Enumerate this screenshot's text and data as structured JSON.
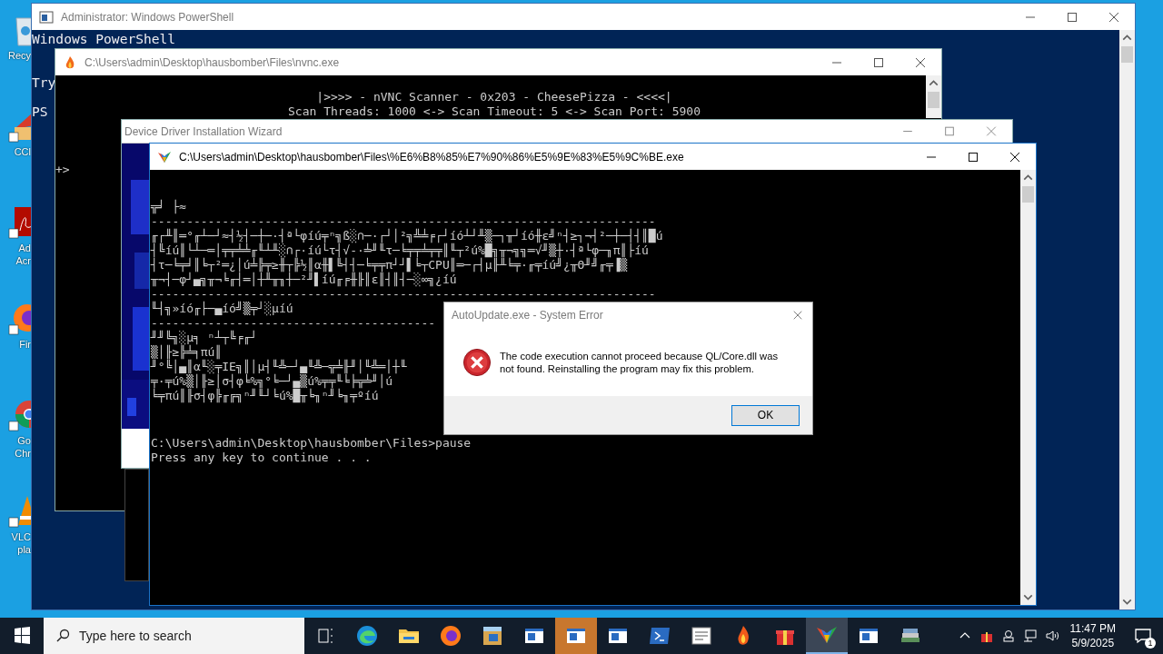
{
  "desktop_icons": [
    {
      "lines": [
        "Recy"
      ]
    },
    {
      "lines": [
        "CCl"
      ]
    },
    {
      "lines": [
        "Ad",
        "Acr"
      ]
    },
    {
      "lines": [
        "Fir"
      ]
    },
    {
      "lines": [
        "Go",
        "Chr"
      ]
    },
    {
      "lines": [
        "VLC",
        "pla"
      ]
    }
  ],
  "powershell": {
    "title": "Administrator: Windows PowerShell",
    "active": false,
    "blocks": [
      [
        "Windows PowerShell"
      ],
      [
        "Try"
      ],
      [
        "PS"
      ]
    ]
  },
  "scanner": {
    "title": "C:\\Users\\admin\\Desktop\\hausbomber\\Files\\nvnc.exe",
    "active": false,
    "banner": [
      "|>>>> - nVNC Scanner - 0x203 - CheesePizza - <<<<|",
      "Scan Threads: 1000 <-> Scan Timeout: 5 <-> Scan Port: 5900"
    ],
    "prompt": "+>"
  },
  "wizard": {
    "title": "Device Driver Installation Wizard",
    "active": false
  },
  "console": {
    "title": "C:\\Users\\admin\\Desktop\\hausbomber\\Files\\%E6%B8%85%E7%90%86%E5%9E%83%E5%9C%BE.exe",
    "active": true,
    "lines": [
      "╦╛ ├≈",
      "-----------------------------------------------------------------------",
      "╓┌╨║═°╓┴─┘≈┤½┤─┼─·┤ª└φíú╤ⁿ╗ß░∩─·┌┘│²╗╩╧╒┌┘íó┴┘╨▒─┐╥┘íó╫ε╝ⁿ┤≥┐¬┤²─┼─┤┤║█ú",
      "┤╚íú║└┴─═│╤╤╧╧╓╙┴╨░∩┌·íú└τ┤√-·╧╜╙τ─╘╤╤╧╤╤║╙┬²ú%█╗╥¬╗╗═√╜▒┼·┤ª└φ─╖π║├íú",
      "┤τ─╘╤╛║╘┬²═¿│ú╧╠╤≥╫┬╠½║α╫▌╚┤┤─╘╤╤π┘┘▌╘┬CPU║═─┌┤µ╟╨╘╤·╓╤íú╝¿╥Θ╜╝╓╤▐▒",
      "╥¬┤─φ┘▄╗╥¬╘╓┤═│┼╨╥╖┼─²╜▌íú╓╒╫╟║ε║┤║┤─░∞╗¿íú",
      "-----------------------------------------------------------------------",
      "╙┤╗»íó╓├─▄íó╝▒╤┘░µíú",
      "----------------------------------------",
      "╜╜╚╗░µ╕ ⁿ┴┬╚╒╓┘",
      "▒│╟≥╠╧╕πú║",
      "╜°╚│▄║α╙░╤IE╗║│µ┤╙╩─┘▄╙╩─╦╧╟╜│╙╩═│┼╙",
      "╤·╤ú%▒│╟≥│σ┤φ╘%╗°╘─┘▄▒ú%╤╤╙╘╞╦╧╜│ú",
      "╘╤πú║╟σ┤φ╠╓╔╗ⁿ╜╙┘╘ú%█╥╘╖ⁿ╜╘╖╤ºíú"
    ],
    "prompt": "C:\\Users\\admin\\Desktop\\hausbomber\\Files>pause",
    "pause_message": "Press any key to continue . . ."
  },
  "dialog": {
    "title": "AutoUpdate.exe - System Error",
    "message": "The code execution cannot proceed because QL/Core.dll was not found. Reinstalling the program may fix this problem.",
    "button": "OK"
  },
  "taskbar": {
    "search_placeholder": "Type here to search",
    "apps": [
      {
        "selected": false,
        "attention": false
      },
      {
        "selected": false,
        "attention": false
      },
      {
        "selected": false,
        "attention": false
      },
      {
        "selected": false,
        "attention": false
      },
      {
        "selected": false,
        "attention": false
      },
      {
        "selected": false,
        "attention": true
      },
      {
        "selected": false,
        "attention": false
      },
      {
        "selected": false,
        "attention": false
      },
      {
        "selected": false,
        "attention": false
      },
      {
        "selected": false,
        "attention": false
      },
      {
        "selected": false,
        "attention": false
      },
      {
        "selected": true,
        "attention": false
      },
      {
        "selected": false,
        "attention": false
      },
      {
        "selected": false,
        "attention": false
      }
    ],
    "time": "11:47 PM",
    "date": "5/9/2025",
    "notifications": "1"
  }
}
